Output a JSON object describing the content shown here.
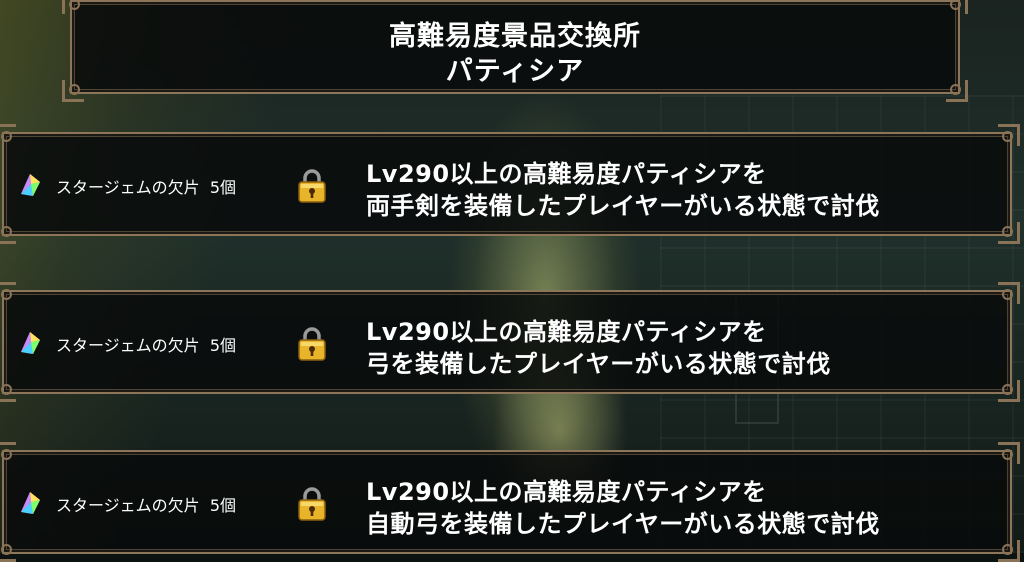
{
  "header": {
    "title_line1": "高難易度景品交換所",
    "title_line2": "パティシア"
  },
  "quests": [
    {
      "reward_label": "スタージェムの欠片",
      "reward_count": "5個",
      "condition_line1": "Lv290以上の高難易度パティシアを",
      "condition_line2": "両手剣を装備したプレイヤーがいる状態で討伐",
      "locked": true
    },
    {
      "reward_label": "スタージェムの欠片",
      "reward_count": "5個",
      "condition_line1": "Lv290以上の高難易度パティシアを",
      "condition_line2": "弓を装備したプレイヤーがいる状態で討伐",
      "locked": true
    },
    {
      "reward_label": "スタージェムの欠片",
      "reward_count": "5個",
      "condition_line1": "Lv290以上の高難易度パティシアを",
      "condition_line2": "自動弓を装備したプレイヤーがいる状態で討伐",
      "locked": true
    }
  ],
  "icons": {
    "reward": "star-gem-fragment-icon",
    "lock": "padlock-icon"
  },
  "colors": {
    "frame": "#8c7558",
    "text": "#ffffff",
    "lock_gold": "#e8b52a"
  }
}
